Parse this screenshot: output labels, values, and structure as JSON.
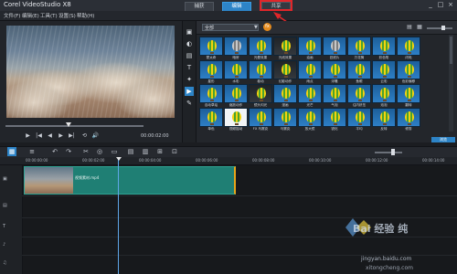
{
  "app": {
    "title": "Corel VideoStudio X8"
  },
  "window_controls": {
    "minimize": "_",
    "maximize": "□",
    "close": "×"
  },
  "menu": [
    "文件(F)",
    "编辑(E)",
    "工具(T)",
    "设置(S)",
    "帮助(H)"
  ],
  "steps": {
    "capture": "捕获",
    "edit": "编辑",
    "share": "共享"
  },
  "library": {
    "dropdown": "全部",
    "thumbs": [
      {
        "label": "蒙太奇",
        "style": "balloon"
      },
      {
        "label": "暗房",
        "style": "grey"
      },
      {
        "label": "光晕效果",
        "style": "balloon"
      },
      {
        "label": "光线效果",
        "style": "dark"
      },
      {
        "label": "油画",
        "style": "balloon"
      },
      {
        "label": "旧底片",
        "style": "grey"
      },
      {
        "label": "万花筒",
        "style": "balloon"
      },
      {
        "label": "彩色笔",
        "style": "balloon"
      },
      {
        "label": "闪电",
        "style": "balloon"
      },
      {
        "label": "星形",
        "style": "balloon"
      },
      {
        "label": "水彩",
        "style": "balloon"
      },
      {
        "label": "卷动",
        "style": "balloon"
      },
      {
        "label": "幻影动作",
        "style": "dark"
      },
      {
        "label": "雨点",
        "style": "balloon"
      },
      {
        "label": "浮雕",
        "style": "balloon"
      },
      {
        "label": "鱼眼",
        "style": "balloon"
      },
      {
        "label": "云彩",
        "style": "balloon"
      },
      {
        "label": "色彩偏移",
        "style": "balloon"
      },
      {
        "label": "自动草绘",
        "style": "balloon"
      },
      {
        "label": "缩放动作",
        "style": "balloon"
      },
      {
        "label": "镜头闪光",
        "style": "dark"
      },
      {
        "label": "漫画",
        "style": "balloon"
      },
      {
        "label": "光芒",
        "style": "balloon"
      },
      {
        "label": "气泡",
        "style": "balloon"
      },
      {
        "label": "往内挤压",
        "style": "balloon"
      },
      {
        "label": "泡泡",
        "style": "balloon"
      },
      {
        "label": "翻转",
        "style": "balloon"
      },
      {
        "label": "单色",
        "style": "balloon"
      },
      {
        "label": "视频摇动",
        "style": "white"
      },
      {
        "label": "FX 马赛克",
        "style": "balloon"
      },
      {
        "label": "马赛克",
        "style": "balloon"
      },
      {
        "label": "放大镜",
        "style": "balloon"
      },
      {
        "label": "锐化",
        "style": "balloon"
      },
      {
        "label": "平均",
        "style": "balloon"
      },
      {
        "label": "反转",
        "style": "balloon"
      },
      {
        "label": "修剪",
        "style": "balloon"
      }
    ],
    "browse_label": "浏览"
  },
  "tools": [
    "▣",
    "◐",
    "▤",
    "T",
    "✦",
    "▶",
    "✎"
  ],
  "playback": {
    "timecode": "00:00:02:00",
    "buttons": [
      "▶",
      "|◀",
      "◀",
      "▶",
      "▶|",
      "⟲",
      "🔊"
    ]
  },
  "timeline": {
    "ruler": [
      "00:00:00:00",
      "00:00:02:00",
      "00:00:04:00",
      "00:00:06:00",
      "00:00:08:00",
      "00:00:10:00",
      "00:00:12:00",
      "00:00:14:00"
    ],
    "clip_name": "视频素材.mp4",
    "toolbar_icons": [
      "▦",
      "≡",
      "↶",
      "↷",
      "✂",
      "◎",
      "▭",
      "▤",
      "▥",
      "⊞",
      "⊡"
    ]
  },
  "watermark": {
    "brand": "Bai 经验  纯",
    "url1": "jingyan.baidu.com",
    "url2": "xitongcheng.com"
  }
}
